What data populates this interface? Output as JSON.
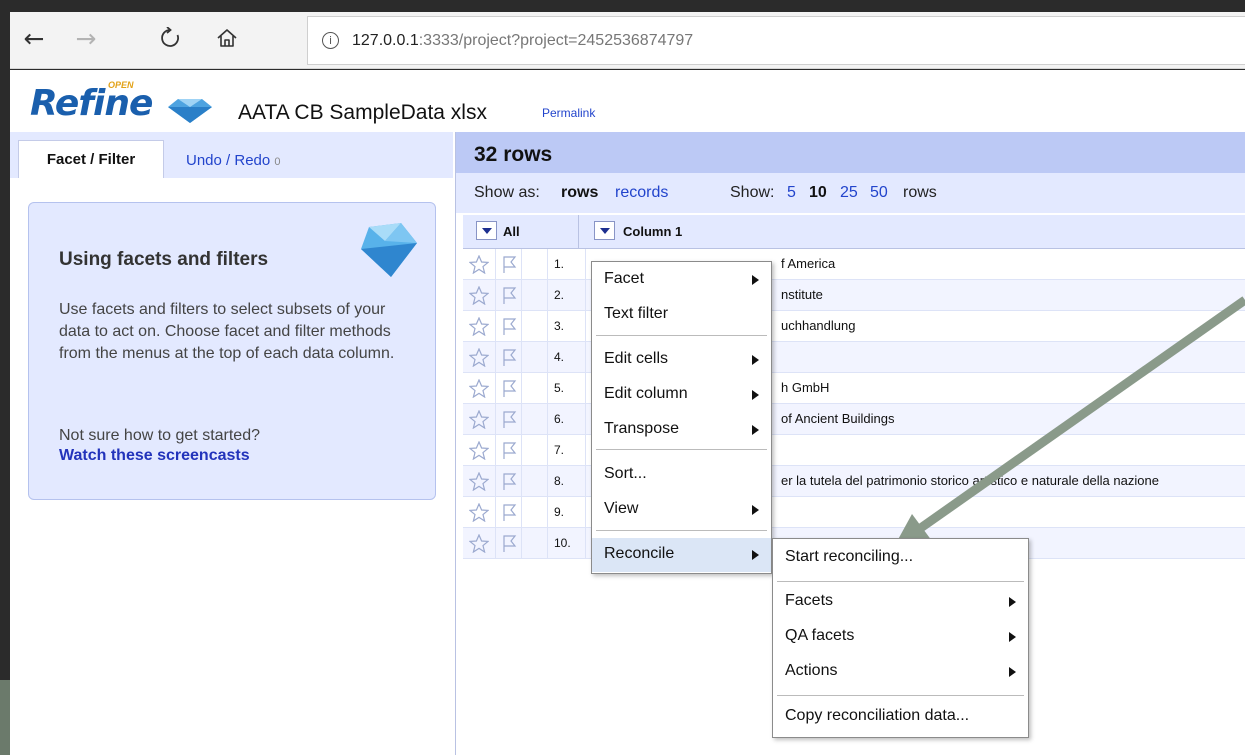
{
  "browser": {
    "back_icon": "arrow-left-icon",
    "forward_icon": "arrow-right-icon",
    "refresh_icon": "refresh-icon",
    "home_icon": "home-icon",
    "url_host": "127.0.0.1",
    "url_rest": ":3333/project?project=2452536874797"
  },
  "header": {
    "logo_open": "OPEN",
    "logo_text": "Refine",
    "project_name": "AATA CB SampleData xlsx",
    "permalink": "Permalink"
  },
  "left_panel": {
    "tabs": [
      {
        "label": "Facet / Filter"
      },
      {
        "label": "Undo / Redo",
        "count": "0"
      }
    ],
    "help": {
      "title": "Using facets and filters",
      "body": "Use facets and filters to select subsets of your data to act on. Choose facet and filter methods from the menus at the top of each data column.",
      "question": "Not sure how to get started?",
      "link": "Watch these screencasts"
    }
  },
  "grid": {
    "row_count": "32 rows",
    "show_as_label": "Show as:",
    "show_as_rows": "rows",
    "show_as_records": "records",
    "show_label": "Show:",
    "page_sizes": [
      "5",
      "10",
      "25",
      "50"
    ],
    "page_size_selected": "10",
    "rows_suffix": "rows",
    "col_all": "All",
    "col_1": "Column 1",
    "rows": [
      {
        "idx": "1.",
        "value": "f America"
      },
      {
        "idx": "2.",
        "value": "nstitute"
      },
      {
        "idx": "3.",
        "value": "uchhandlung"
      },
      {
        "idx": "4.",
        "value": ""
      },
      {
        "idx": "5.",
        "value": "h GmbH"
      },
      {
        "idx": "6.",
        "value": "of Ancient Buildings"
      },
      {
        "idx": "7.",
        "value": ""
      },
      {
        "idx": "8.",
        "value": "er la tutela del patrimonio storico artistico e naturale della nazione"
      },
      {
        "idx": "9.",
        "value": ""
      },
      {
        "idx": "10.",
        "value": ""
      }
    ]
  },
  "column_menu": {
    "items": [
      {
        "label": "Facet",
        "submenu": true
      },
      {
        "label": "Text filter",
        "submenu": false
      },
      {
        "label": "Edit cells",
        "submenu": true
      },
      {
        "label": "Edit column",
        "submenu": true
      },
      {
        "label": "Transpose",
        "submenu": true
      },
      {
        "label": "Sort...",
        "submenu": false
      },
      {
        "label": "View",
        "submenu": true
      },
      {
        "label": "Reconcile",
        "submenu": true
      }
    ]
  },
  "reconcile_menu": {
    "items": [
      {
        "label": "Start reconciling...",
        "submenu": false
      },
      {
        "label": "Facets",
        "submenu": true
      },
      {
        "label": "QA facets",
        "submenu": true
      },
      {
        "label": "Actions",
        "submenu": true
      },
      {
        "label": "Copy reconciliation data...",
        "submenu": false
      }
    ]
  },
  "annotation": {
    "arrow_color": "#8a9a8a",
    "points_to": "Start reconciling..."
  }
}
